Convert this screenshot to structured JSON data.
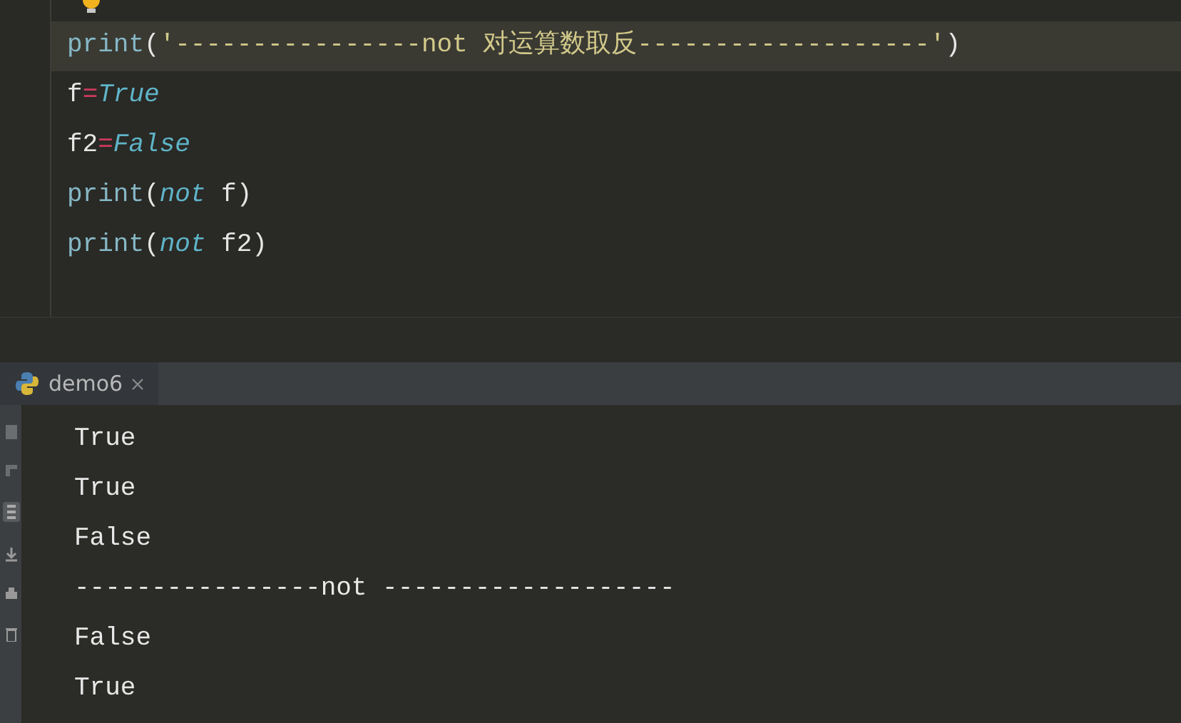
{
  "editor": {
    "lines": [
      {
        "current": true,
        "tokens": [
          {
            "text": "print",
            "kind": "builtin"
          },
          {
            "text": "(",
            "kind": "plain"
          },
          {
            "text": "'----------------not 对运算数取反-------------------'",
            "kind": "string"
          },
          {
            "text": ")",
            "kind": "plain"
          }
        ]
      },
      {
        "current": false,
        "tokens": [
          {
            "text": "f",
            "kind": "plain"
          },
          {
            "text": "=",
            "kind": "operator"
          },
          {
            "text": "True",
            "kind": "keyword"
          }
        ]
      },
      {
        "current": false,
        "tokens": [
          {
            "text": "f2",
            "kind": "plain"
          },
          {
            "text": "=",
            "kind": "operator"
          },
          {
            "text": "False",
            "kind": "keyword"
          }
        ]
      },
      {
        "current": false,
        "tokens": [
          {
            "text": "print",
            "kind": "builtin"
          },
          {
            "text": "(",
            "kind": "plain"
          },
          {
            "text": "not",
            "kind": "keyword"
          },
          {
            "text": " f)",
            "kind": "plain"
          }
        ]
      },
      {
        "current": false,
        "tokens": [
          {
            "text": "print",
            "kind": "builtin"
          },
          {
            "text": "(",
            "kind": "plain"
          },
          {
            "text": "not",
            "kind": "keyword"
          },
          {
            "text": " f2)",
            "kind": "plain"
          }
        ]
      }
    ]
  },
  "run_panel": {
    "tabs": [
      {
        "label": "demo6",
        "selected": true
      }
    ],
    "output": [
      "True",
      "True",
      "False",
      "----------------not -------------------",
      "False",
      "True"
    ]
  }
}
